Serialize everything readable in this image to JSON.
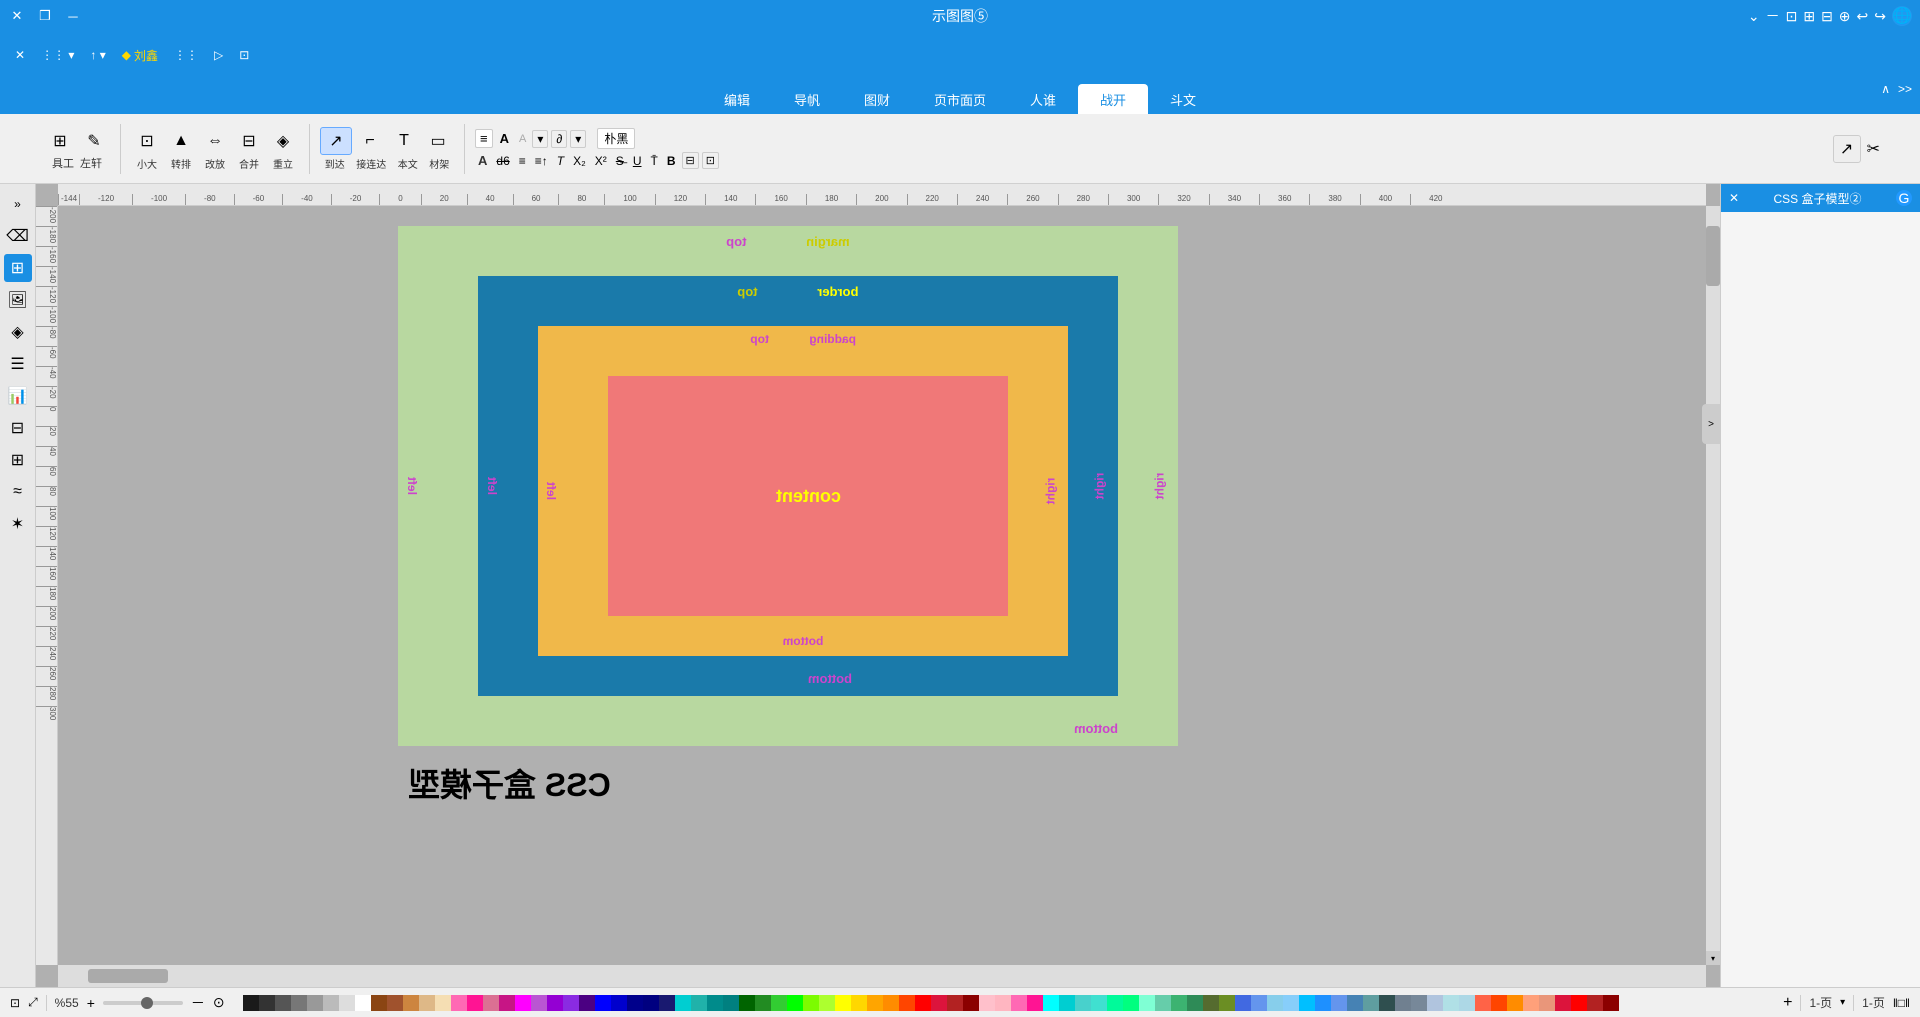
{
  "titlebar": {
    "title": "示图图⑤",
    "close_label": "✕",
    "restore_label": "❐",
    "minimize_label": "－",
    "copy_label": "❒"
  },
  "toolbar1": {
    "items": [
      {
        "label": "✕",
        "name": "close"
      },
      {
        "label": "❒",
        "name": "copy"
      },
      {
        "label": "－",
        "name": "minimize"
      },
      {
        "label": "◆ 刘鑫",
        "name": "user"
      },
      {
        "label": "⋮⋮",
        "name": "arrange"
      },
      {
        "label": "▷",
        "name": "play"
      },
      {
        "label": "⊡",
        "name": "table"
      }
    ]
  },
  "navtabs": {
    "tabs": [
      {
        "label": "编辑",
        "active": false
      },
      {
        "label": "导帆",
        "active": false
      },
      {
        "label": "图财",
        "active": false
      },
      {
        "label": "页市面页",
        "active": false
      },
      {
        "label": "人谁",
        "active": false
      },
      {
        "label": "战开",
        "active": true
      },
      {
        "label": "斗文",
        "active": false
      }
    ]
  },
  "toolbar2": {
    "groups": [
      {
        "name": "tools",
        "items": [
          {
            "label": "⊞",
            "text": "具工"
          },
          {
            "label": "✎",
            "text": "左轩"
          }
        ]
      },
      {
        "name": "transform",
        "items": [
          {
            "label": "⊡",
            "text": "小大"
          },
          {
            "label": "▲",
            "text": "转排"
          },
          {
            "label": "⇔",
            "text": "改放"
          },
          {
            "label": "⊟",
            "text": "合并"
          },
          {
            "label": "◈",
            "text": "重立"
          }
        ]
      },
      {
        "name": "select",
        "items": [
          {
            "label": "↗",
            "text": "到达",
            "active": true
          },
          {
            "label": "⌐",
            "text": "接连达"
          },
          {
            "label": "T",
            "text": "本文"
          },
          {
            "label": "▭",
            "text": "材架"
          }
        ]
      }
    ],
    "right_label": "朴黑"
  },
  "diagram": {
    "title": "CSS 盒子模型",
    "margin_label": "margin",
    "border_label": "border",
    "padding_label": "padding",
    "content_label": "content",
    "top_label": "top",
    "bottom_label": "bottom",
    "left_label": "left",
    "right_label": "right",
    "margin_color": "#b8d8a0",
    "border_color": "#1a7aaa",
    "padding_color": "#f0b84a",
    "content_color": "#f07878"
  },
  "panel": {
    "title": "CSS 盒子模型②",
    "close_label": "✕"
  },
  "statusbar": {
    "zoom_label": "%55",
    "zoom_icon": "⊕",
    "page_label": "1-页",
    "page_label2": "1-页",
    "fit_label": "||口|"
  },
  "colors": [
    "#1a1a1a",
    "#333",
    "#555",
    "#777",
    "#999",
    "#bbb",
    "#ddd",
    "#fff",
    "#8B4513",
    "#A0522D",
    "#CD853F",
    "#DEB887",
    "#F5DEB3",
    "#FF69B4",
    "#FF1493",
    "#DB7093",
    "#C71585",
    "#FF00FF",
    "#BA55D3",
    "#9400D3",
    "#8A2BE2",
    "#4B0082",
    "#0000FF",
    "#0000CD",
    "#00008B",
    "#000080",
    "#191970",
    "#00CED1",
    "#20B2AA",
    "#008B8B",
    "#008080",
    "#006400",
    "#228B22",
    "#32CD32",
    "#00FF00",
    "#7CFC00",
    "#ADFF2F",
    "#FFFF00",
    "#FFD700",
    "#FFA500",
    "#FF8C00",
    "#FF4500",
    "#FF0000",
    "#DC143C",
    "#B22222",
    "#8B0000",
    "#FFC0CB",
    "#FFB6C1",
    "#FF69B4",
    "#FF1493",
    "#00FFFF",
    "#00CED1",
    "#48D1CC",
    "#40E0D0",
    "#00FA9A",
    "#00FF7F",
    "#7FFFD4",
    "#66CDAA",
    "#3CB371",
    "#2E8B57",
    "#556B2F",
    "#6B8E23",
    "#4169E1",
    "#6495ED",
    "#87CEEB",
    "#87CEFA",
    "#00BFFF",
    "#1E90FF",
    "#6495ED",
    "#4682B4",
    "#5F9EA0",
    "#2F4F4F",
    "#708090",
    "#778899",
    "#B0C4DE",
    "#B0E0E6",
    "#ADD8E6",
    "#FF6347",
    "#FF4500",
    "#FF8C00",
    "#FFA07A",
    "#E9967A",
    "#DC143C",
    "#FF0000",
    "#B22222",
    "#8B0000"
  ]
}
